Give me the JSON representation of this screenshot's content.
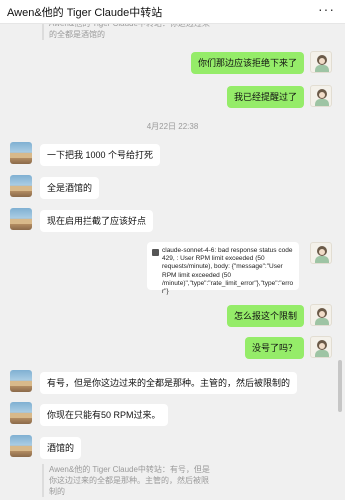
{
  "window": {
    "title": "Awen&他的 Tiger Claude中转站",
    "menu_icon": "more-dots-icon"
  },
  "top_quote": {
    "text": "Awen&他的 Tiger Claude中转站：你这边过来的全都是酒馆的"
  },
  "messages_top": [
    {
      "text": "你们那边应该拒绝下来了"
    },
    {
      "text": "我已经提醒过了"
    }
  ],
  "timestamp": "4月22日 22:38",
  "messages_mid": [
    {
      "text": "一下把我 1000 个号给打死"
    },
    {
      "text": "全是酒馆的"
    },
    {
      "text": "现在启用拦截了应该好点"
    }
  ],
  "error_card": {
    "icon": "document-icon",
    "text": "claude-sonnet-4-6: bad response status code 429, : User RPM limit exceeded (50 requests/minute), body: {\"message\":\"User RPM limit exceeded (50 /minute)\",\"type\":\"rate_limit_error\"},\"type\":\"error\"}"
  },
  "messages_self2": [
    {
      "text": "怎么报这个限制"
    },
    {
      "text": "没号了吗？"
    }
  ],
  "messages_bottom": [
    {
      "text": "有号，但是你这边过来的全都是那种。主管的，然后被限制的"
    },
    {
      "text": "你现在只能有50 RPM过来。"
    },
    {
      "text": "酒馆的"
    }
  ],
  "bottom_quote": {
    "text": "Awen&他的 Tiger Claude中转站：有号，但是你这边过来的全都是那种。主管的，然后被限制的"
  },
  "colors": {
    "self_bubble": "#95ec69",
    "other_bubble": "#ffffff",
    "chat_background": "#f0f0f0"
  }
}
